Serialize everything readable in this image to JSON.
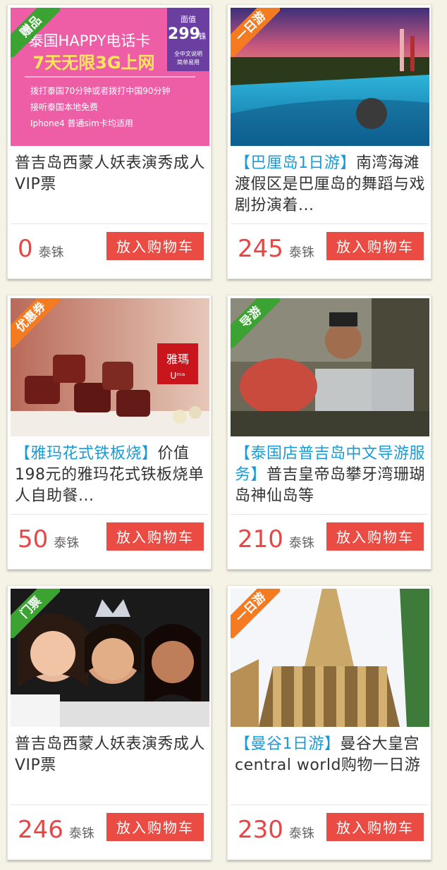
{
  "products": [
    {
      "badge": "赠品",
      "badge_color": "#3ba332",
      "title_tag": "",
      "title": "普吉岛西蒙人妖表演秀成人VIP票",
      "price": "0",
      "unit": "泰铢",
      "button": "放入购物车",
      "image": {
        "heading": "泰国HAPPY电话卡",
        "subheading": "7天无限3G上网",
        "price_label": "面值",
        "price_value": "299",
        "price_unit": "铢",
        "note1": "全中文说明",
        "note2": "简单易用",
        "lines": [
          "拨打泰国70分钟或者拨打中国90分钟",
          "接听泰国本地免费",
          "Iphone4 普通sim卡均适用"
        ]
      }
    },
    {
      "badge": "一日游",
      "badge_color": "#f47b1f",
      "title_tag": "【巴厘岛1日游】",
      "title": "南湾海滩渡假区是巴厘岛的舞蹈与戏剧扮演着...",
      "price": "245",
      "unit": "泰铢",
      "button": "放入购物车"
    },
    {
      "badge": "优惠券",
      "badge_color": "#f47b1f",
      "title_tag": "【雅玛花式铁板烧】",
      "title": "价值198元的雅玛花式铁板烧单人自助餐...",
      "price": "50",
      "unit": "泰铢",
      "button": "放入购物车",
      "image": {
        "logo_cn": "雅瑪",
        "logo_en": "Uᵐᵃ"
      }
    },
    {
      "badge": "导游",
      "badge_color": "#3ba332",
      "title_tag": "【泰国店普吉岛中文导游服务】",
      "title": "普吉皇帝岛攀牙湾珊瑚岛神仙岛等",
      "price": "210",
      "unit": "泰铢",
      "button": "放入购物车"
    },
    {
      "badge": "门票",
      "badge_color": "#3ba332",
      "title_tag": "",
      "title": "普吉岛西蒙人妖表演秀成人VIP票",
      "price": "246",
      "unit": "泰铢",
      "button": "放入购物车"
    },
    {
      "badge": "一日游",
      "badge_color": "#f47b1f",
      "title_tag": "【曼谷1日游】",
      "title": "曼谷大皇宫central world购物一日游",
      "price": "230",
      "unit": "泰铢",
      "button": "放入购物车"
    }
  ]
}
